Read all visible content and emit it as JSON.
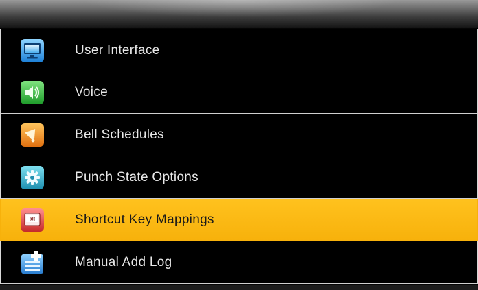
{
  "menu": {
    "items": [
      {
        "label": "User Interface",
        "icon": "monitor-icon",
        "selected": false
      },
      {
        "label": "Voice",
        "icon": "speaker-icon",
        "selected": false
      },
      {
        "label": "Bell Schedules",
        "icon": "bell-icon",
        "selected": false
      },
      {
        "label": "Punch State Options",
        "icon": "gear-icon",
        "selected": false
      },
      {
        "label": "Shortcut Key Mappings",
        "icon": "alt-key-icon",
        "selected": true
      },
      {
        "label": "Manual Add Log",
        "icon": "add-log-icon",
        "selected": false
      }
    ]
  },
  "icon_text": {
    "alt_key": "alt"
  },
  "colors": {
    "background": "#050505",
    "selected_row": "#ffc21e",
    "text": "#e8e8e8",
    "selected_text": "#1a1a1a"
  }
}
